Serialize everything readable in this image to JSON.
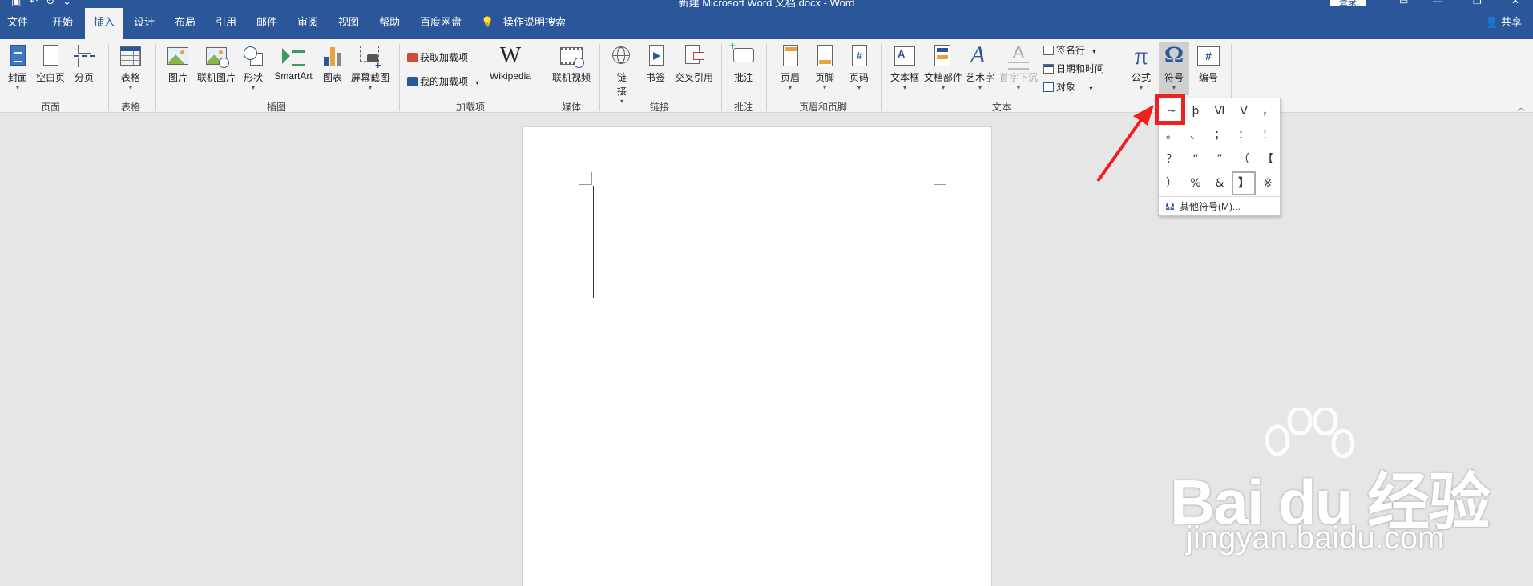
{
  "titlebar": {
    "title": "新建 Microsoft Word 文档.docx  -  Word",
    "login": "登录"
  },
  "tabs": [
    "文件",
    "开始",
    "插入",
    "设计",
    "布局",
    "引用",
    "邮件",
    "审阅",
    "视图",
    "帮助",
    "百度网盘"
  ],
  "active_tab": "插入",
  "tell_me": "操作说明搜索",
  "share": "共享",
  "ribbon": {
    "pages": {
      "cover": "封面",
      "blank": "空白页",
      "pagebreak": "分页",
      "group": "页面"
    },
    "tables": {
      "table": "表格",
      "group": "表格"
    },
    "illustrations": {
      "picture": "图片",
      "online_picture": "联机图片",
      "shapes": "形状",
      "smartart": "SmartArt",
      "chart": "图表",
      "screenshot": "屏幕截图",
      "group": "插图"
    },
    "addins": {
      "get": "获取加载项",
      "my": "我的加载项",
      "wikipedia": "Wikipedia",
      "group": "加载项"
    },
    "media": {
      "online_video": "联机视频",
      "group": "媒体"
    },
    "links": {
      "link_1": "链",
      "link_2": "接",
      "bookmark": "书签",
      "xref": "交叉引用",
      "group": "链接"
    },
    "comments": {
      "comment": "批注",
      "group": "批注"
    },
    "header_footer": {
      "header": "页眉",
      "footer": "页脚",
      "page_number": "页码",
      "group": "页眉和页脚"
    },
    "text": {
      "textbox": "文本框",
      "quick_parts": "文档部件",
      "wordart": "艺术字",
      "dropcap": "首字下沉",
      "signature": "签名行",
      "datetime": "日期和时间",
      "object": "对象",
      "group": "文本"
    },
    "symbols": {
      "equation": "公式",
      "symbol": "符号",
      "number": "编号"
    }
  },
  "symbol_menu": {
    "rows": [
      [
        "~",
        "þ",
        "Ⅵ",
        "Ⅴ",
        "，"
      ],
      [
        "。",
        "、",
        "；",
        "：",
        "！"
      ],
      [
        "？",
        "“",
        "”",
        "（",
        "【"
      ],
      [
        "）",
        "%",
        "&",
        "】",
        "※"
      ]
    ],
    "selected": "】",
    "more": "其他符号(M)..."
  },
  "watermark": {
    "brand": "Bai du 经验",
    "url": "jingyan.baidu.com"
  },
  "colors": {
    "accent": "#2b579a",
    "highlight": "#f02020"
  }
}
